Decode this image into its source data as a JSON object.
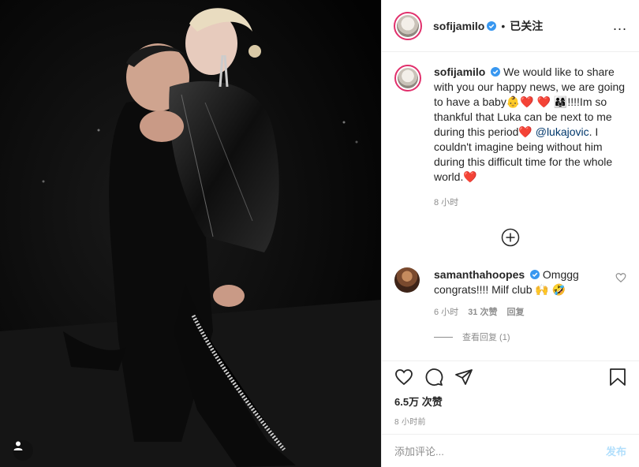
{
  "header": {
    "username": "sofijamilo",
    "separator": "•",
    "follow_status": "已关注",
    "more": "..."
  },
  "caption": {
    "username": "sofijamilo",
    "text_1": "We would like to share with you our happy news, we are going to have a baby",
    "emoji_1": "👶❤️ ❤️ 👨‍👩‍👧",
    "text_2": "!!!!Im so thankful that Luka can be next to me during this period",
    "emoji_2": "❤️",
    "mention": "@lukajovic",
    "text_3": ". I couldn't imagine being without him during this difficult time for the whole world.",
    "emoji_3": "❤️",
    "time": "8 小时"
  },
  "comment": {
    "username": "samanthahoopes",
    "text": "Omggg congrats!!!! Milf club",
    "emoji": "🙌 🤣",
    "time": "6 小时",
    "likes": "31 次赞",
    "reply": "回复",
    "view_replies": "查看回复 (1)"
  },
  "stats": {
    "likes_count": "6.5万",
    "likes_label": "次赞",
    "time": "8 小时前"
  },
  "composer": {
    "placeholder": "添加评论...",
    "post": "发布"
  }
}
